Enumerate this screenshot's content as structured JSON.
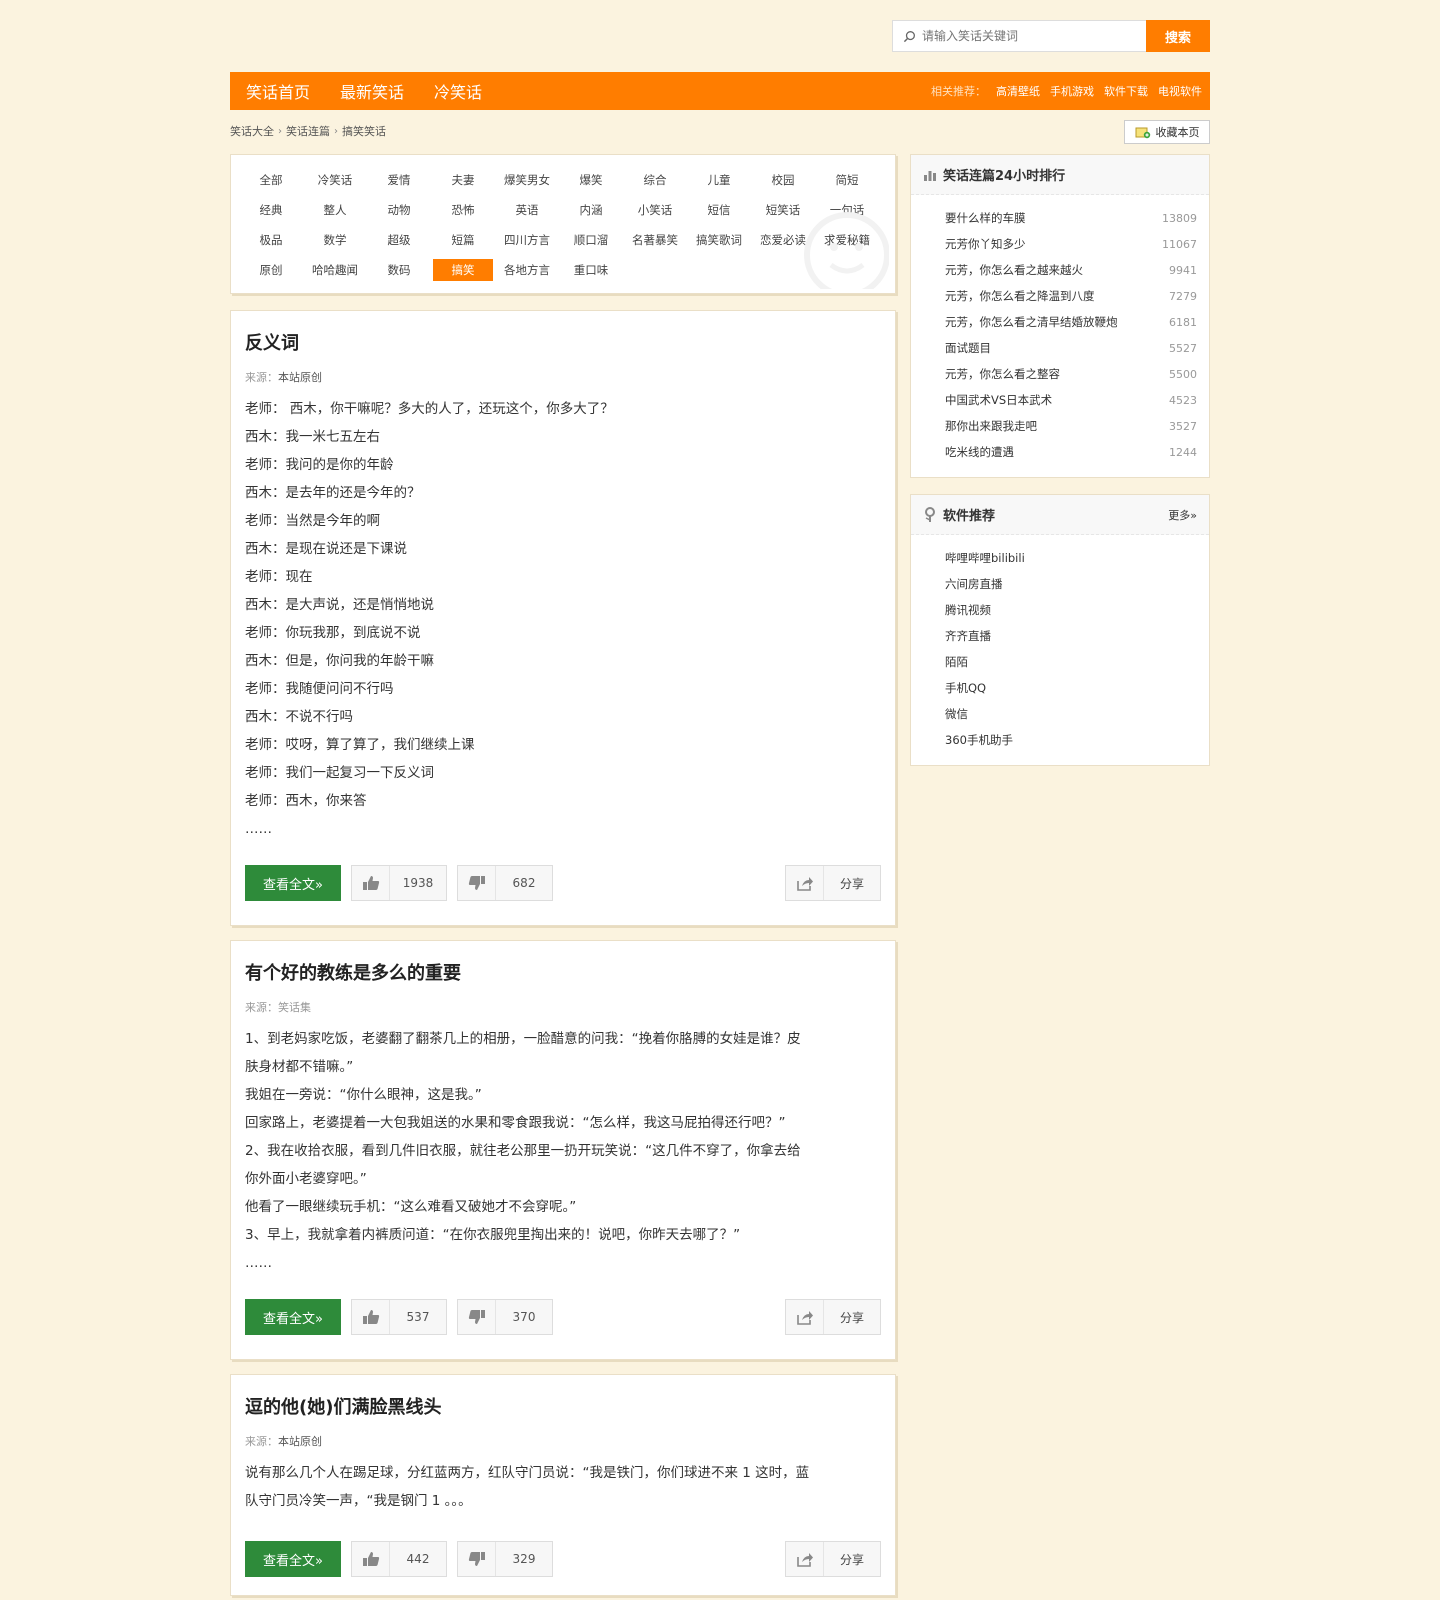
{
  "search": {
    "placeholder": "请输入笑话关键词",
    "button": "搜索"
  },
  "nav": {
    "links": [
      "笑话首页",
      "最新笑话",
      "冷笑话"
    ],
    "related_label": "相关推荐：",
    "related": [
      "高清壁纸",
      "手机游戏",
      "软件下载",
      "电视软件"
    ]
  },
  "breadcrumb": [
    "笑话大全",
    "笑话连篇",
    "搞笑笑话"
  ],
  "favorite": "收藏本页",
  "categories": [
    "全部",
    "冷笑话",
    "爱情",
    "夫妻",
    "爆笑男女",
    "爆笑",
    "综合",
    "儿童",
    "校园",
    "简短",
    "经典",
    "整人",
    "动物",
    "恐怖",
    "英语",
    "内涵",
    "小笑话",
    "短信",
    "短笑话",
    "一句话",
    "极品",
    "数学",
    "超级",
    "短篇",
    "四川方言",
    "顺口溜",
    "名著暴笑",
    "搞笑歌词",
    "恋爱必读",
    "求爱秘籍",
    "原创",
    "哈哈趣闻",
    "数码",
    "搞笑",
    "各地方言",
    "重口味"
  ],
  "active_category": "搞笑",
  "articles": [
    {
      "title": "反义词",
      "source_label": "来源：",
      "source": "本站原创",
      "lines": [
        "老师： 西木，你干嘛呢？多大的人了，还玩这个，你多大了？",
        "西木：我一米七五左右",
        "老师：我问的是你的年龄",
        "西木：是去年的还是今年的？",
        "老师：当然是今年的啊",
        "西木：是现在说还是下课说",
        "老师：现在",
        "西木：是大声说，还是悄悄地说",
        "老师：你玩我那，到底说不说",
        "西木：但是，你问我的年龄干嘛",
        "老师：我随便问问不行吗",
        "西木：不说不行吗",
        "老师：哎呀，算了算了，我们继续上课",
        "老师：我们一起复习一下反义词",
        "老师：西木，你来答",
        "……"
      ],
      "read_more": "查看全文»",
      "likes": "1938",
      "dislikes": "682",
      "share": "分享"
    },
    {
      "title": "有个好的教练是多么的重要",
      "source_label": "来源：",
      "source": "笑话集",
      "lines": [
        "1、到老妈家吃饭，老婆翻了翻茶几上的相册，一脸醋意的问我：“挽着你胳膊的女娃是谁？皮",
        "肤身材都不错嘛。”",
        "我姐在一旁说：“你什么眼神，这是我。”",
        "回家路上，老婆提着一大包我姐送的水果和零食跟我说：“怎么样，我这马屁拍得还行吧？”",
        "2、我在收拾衣服，看到几件旧衣服，就往老公那里一扔开玩笑说：“这几件不穿了，你拿去给",
        "你外面小老婆穿吧。”",
        "他看了一眼继续玩手机：“这么难看又破她才不会穿呢。”",
        "3、早上，我就拿着内裤质问道：“在你衣服兜里掏出来的！说吧，你昨天去哪了？”",
        "……"
      ],
      "read_more": "查看全文»",
      "likes": "537",
      "dislikes": "370",
      "share": "分享"
    },
    {
      "title": "逗的他(她)们满脸黑线头",
      "source_label": "来源：",
      "source": "本站原创",
      "lines": [
        "说有那么几个人在踢足球，分红蓝两方，红队守门员说：“我是铁门，你们球进不来 1 这时，蓝",
        "队守门员冷笑一声，“我是钢门 1 。。。"
      ],
      "read_more": "查看全文»",
      "likes": "442",
      "dislikes": "329",
      "share": "分享"
    }
  ],
  "ranking": {
    "title": "笑话连篇24小时排行",
    "items": [
      {
        "name": "要什么样的车膜",
        "count": "13809"
      },
      {
        "name": "元芳你丫知多少",
        "count": "11067"
      },
      {
        "name": "元芳，你怎么看之越来越火",
        "count": "9941"
      },
      {
        "name": "元芳，你怎么看之降温到八度",
        "count": "7279"
      },
      {
        "name": "元芳，你怎么看之清早结婚放鞭炮",
        "count": "6181"
      },
      {
        "name": "面试题目",
        "count": "5527"
      },
      {
        "name": "元芳，你怎么看之整容",
        "count": "5500"
      },
      {
        "name": "中国武术VS日本武术",
        "count": "4523"
      },
      {
        "name": "那你出来跟我走吧",
        "count": "3527"
      },
      {
        "name": "吃米线的遭遇",
        "count": "1244"
      }
    ]
  },
  "software": {
    "title": "软件推荐",
    "more": "更多»",
    "items": [
      "哔哩哔哩bilibili",
      "六间房直播",
      "腾讯视频",
      "齐齐直播",
      "陌陌",
      "手机QQ",
      "微信",
      "360手机助手"
    ]
  },
  "colors": {
    "accent": "#ff7d00",
    "green_button": "#2e8b3a",
    "background": "#fbf3df"
  }
}
